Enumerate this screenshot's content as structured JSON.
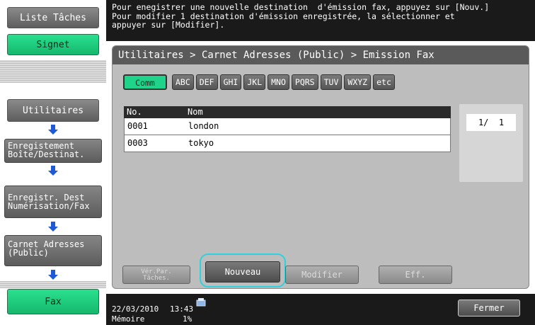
{
  "sidebar": {
    "job_list_label": "Liste Tâches",
    "bookmark_label": "Signet",
    "steps": [
      "Utilitaires",
      "Enregistement\nBoîte/Destinat.",
      "Enregistr. Dest\nNumérisation/Fax",
      "Carnet Adresses\n(Public)"
    ],
    "fax_label": "Fax"
  },
  "message": "Pour enegistrer une nouvelle destination  d'émission fax, appuyez sur [Nouv.]\nPour modifier 1 destination d'émission enregistrée, la sélectionner et\nappuyer sur [Modifier].",
  "breadcrumb": "Utilitaires > Carnet Adresses (Public) > Emission Fax",
  "tabs": [
    "Comm",
    "ABC",
    "DEF",
    "GHI",
    "JKL",
    "MNO",
    "PQRS",
    "TUV",
    "WXYZ",
    "etc"
  ],
  "list": {
    "col_no": "No.",
    "col_name": "Nom",
    "rows": [
      {
        "no": "0001",
        "name": "london"
      },
      {
        "no": "0003",
        "name": "tokyo"
      }
    ]
  },
  "pager": "1/  1",
  "actions": {
    "check_jobs": "Vér.Par.\nTâches.",
    "new": "Nouveau",
    "modify": "Modifier",
    "delete": "Eff."
  },
  "status": {
    "date": "22/03/2010",
    "time": "13:43",
    "memory_label": "Mémoire",
    "memory_value": "1%"
  },
  "close_label": "Fermer",
  "colors": {
    "accent": "#1fd48a",
    "highlight_ring": "#2ed2dc"
  }
}
